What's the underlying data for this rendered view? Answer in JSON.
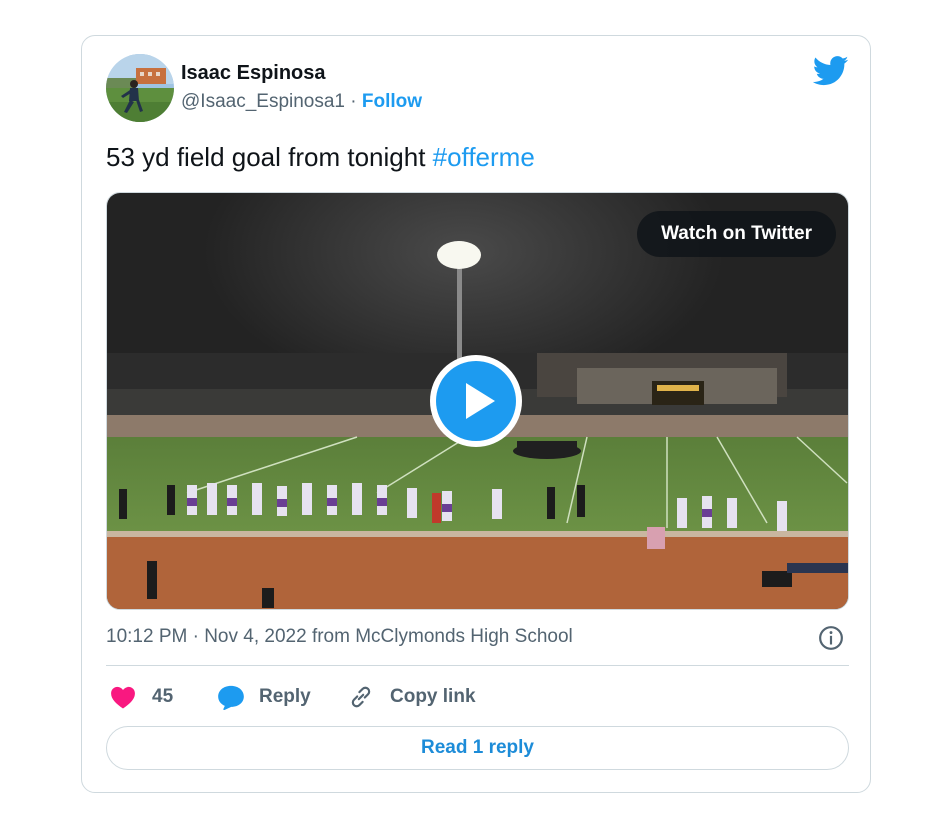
{
  "author": {
    "name": "Isaac Espinosa",
    "handle": "@Isaac_Espinosa1",
    "separator": "·",
    "follow_label": "Follow"
  },
  "tweet": {
    "text": "53 yd field goal from tonight ",
    "hashtag": "#offerme"
  },
  "media": {
    "watch_label": "Watch on Twitter"
  },
  "meta": {
    "text": "10:12 PM · Nov 4, 2022 from McClymonds High School"
  },
  "actions": {
    "like_count": "45",
    "reply_label": "Reply",
    "copy_label": "Copy link"
  },
  "read_reply_label": "Read 1 reply",
  "icons": {
    "brand": "twitter-bird-icon",
    "like": "heart-icon",
    "reply": "speech-bubble-icon",
    "copy": "link-icon",
    "info": "info-icon",
    "play": "play-icon"
  },
  "colors": {
    "accent": "#1d9bf0",
    "like": "#f91880",
    "text": "#0f1419",
    "secondary": "#536471",
    "border": "#cfd9de"
  }
}
